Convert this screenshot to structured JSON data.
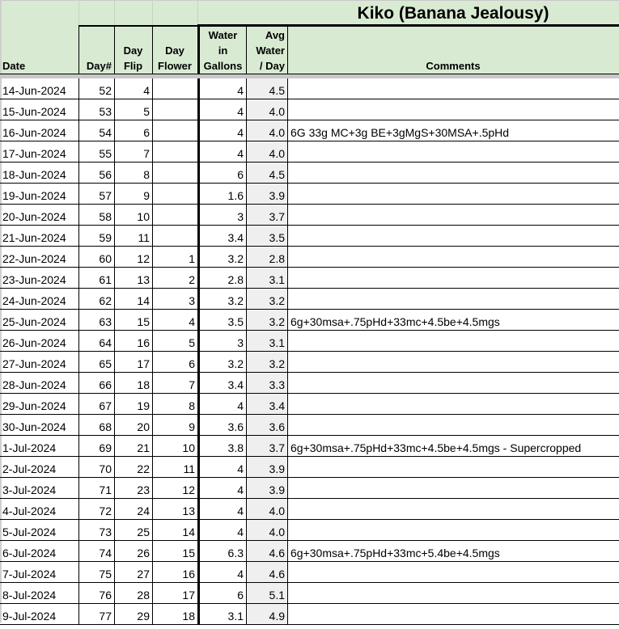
{
  "sheet": {
    "title": "Kiko (Banana Jealousy)",
    "colors": {
      "header_fill": "#d9ead3",
      "avg_column_fill": "#efefef",
      "frozen_pane_band": "#c8c8c8"
    },
    "columns": {
      "date": "Date",
      "day_num": "Day#",
      "day_flip": [
        "Day",
        "Flip"
      ],
      "day_flower": [
        "Day",
        "Flower"
      ],
      "water": [
        "Water",
        "in",
        "Gallons"
      ],
      "avg_water": [
        "Avg",
        "Water",
        "/ Day"
      ],
      "comments": "Comments"
    },
    "rows": [
      {
        "date": "14-Jun-2024",
        "day": "52",
        "flip": "4",
        "flower": "",
        "water": "4",
        "avg": "4.5",
        "comment": ""
      },
      {
        "date": "15-Jun-2024",
        "day": "53",
        "flip": "5",
        "flower": "",
        "water": "4",
        "avg": "4.0",
        "comment": ""
      },
      {
        "date": "16-Jun-2024",
        "day": "54",
        "flip": "6",
        "flower": "",
        "water": "4",
        "avg": "4.0",
        "comment": "6G 33g MC+3g BE+3gMgS+30MSA+.5pHd"
      },
      {
        "date": "17-Jun-2024",
        "day": "55",
        "flip": "7",
        "flower": "",
        "water": "4",
        "avg": "4.0",
        "comment": ""
      },
      {
        "date": "18-Jun-2024",
        "day": "56",
        "flip": "8",
        "flower": "",
        "water": "6",
        "avg": "4.5",
        "comment": ""
      },
      {
        "date": "19-Jun-2024",
        "day": "57",
        "flip": "9",
        "flower": "",
        "water": "1.6",
        "avg": "3.9",
        "comment": ""
      },
      {
        "date": "20-Jun-2024",
        "day": "58",
        "flip": "10",
        "flower": "",
        "water": "3",
        "avg": "3.7",
        "comment": ""
      },
      {
        "date": "21-Jun-2024",
        "day": "59",
        "flip": "11",
        "flower": "",
        "water": "3.4",
        "avg": "3.5",
        "comment": ""
      },
      {
        "date": "22-Jun-2024",
        "day": "60",
        "flip": "12",
        "flower": "1",
        "water": "3.2",
        "avg": "2.8",
        "comment": ""
      },
      {
        "date": "23-Jun-2024",
        "day": "61",
        "flip": "13",
        "flower": "2",
        "water": "2.8",
        "avg": "3.1",
        "comment": ""
      },
      {
        "date": "24-Jun-2024",
        "day": "62",
        "flip": "14",
        "flower": "3",
        "water": "3.2",
        "avg": "3.2",
        "comment": ""
      },
      {
        "date": "25-Jun-2024",
        "day": "63",
        "flip": "15",
        "flower": "4",
        "water": "3.5",
        "avg": "3.2",
        "comment": "6g+30msa+.75pHd+33mc+4.5be+4.5mgs"
      },
      {
        "date": "26-Jun-2024",
        "day": "64",
        "flip": "16",
        "flower": "5",
        "water": "3",
        "avg": "3.1",
        "comment": ""
      },
      {
        "date": "27-Jun-2024",
        "day": "65",
        "flip": "17",
        "flower": "6",
        "water": "3.2",
        "avg": "3.2",
        "comment": ""
      },
      {
        "date": "28-Jun-2024",
        "day": "66",
        "flip": "18",
        "flower": "7",
        "water": "3.4",
        "avg": "3.3",
        "comment": ""
      },
      {
        "date": "29-Jun-2024",
        "day": "67",
        "flip": "19",
        "flower": "8",
        "water": "4",
        "avg": "3.4",
        "comment": ""
      },
      {
        "date": "30-Jun-2024",
        "day": "68",
        "flip": "20",
        "flower": "9",
        "water": "3.6",
        "avg": "3.6",
        "comment": ""
      },
      {
        "date": "1-Jul-2024",
        "day": "69",
        "flip": "21",
        "flower": "10",
        "water": "3.8",
        "avg": "3.7",
        "comment": "6g+30msa+.75pHd+33mc+4.5be+4.5mgs - Supercropped"
      },
      {
        "date": "2-Jul-2024",
        "day": "70",
        "flip": "22",
        "flower": "11",
        "water": "4",
        "avg": "3.9",
        "comment": ""
      },
      {
        "date": "3-Jul-2024",
        "day": "71",
        "flip": "23",
        "flower": "12",
        "water": "4",
        "avg": "3.9",
        "comment": ""
      },
      {
        "date": "4-Jul-2024",
        "day": "72",
        "flip": "24",
        "flower": "13",
        "water": "4",
        "avg": "4.0",
        "comment": ""
      },
      {
        "date": "5-Jul-2024",
        "day": "73",
        "flip": "25",
        "flower": "14",
        "water": "4",
        "avg": "4.0",
        "comment": ""
      },
      {
        "date": "6-Jul-2024",
        "day": "74",
        "flip": "26",
        "flower": "15",
        "water": "6.3",
        "avg": "4.6",
        "comment": "6g+30msa+.75pHd+33mc+5.4be+4.5mgs"
      },
      {
        "date": "7-Jul-2024",
        "day": "75",
        "flip": "27",
        "flower": "16",
        "water": "4",
        "avg": "4.6",
        "comment": ""
      },
      {
        "date": "8-Jul-2024",
        "day": "76",
        "flip": "28",
        "flower": "17",
        "water": "6",
        "avg": "5.1",
        "comment": ""
      },
      {
        "date": "9-Jul-2024",
        "day": "77",
        "flip": "29",
        "flower": "18",
        "water": "3.1",
        "avg": "4.9",
        "comment": ""
      }
    ]
  }
}
